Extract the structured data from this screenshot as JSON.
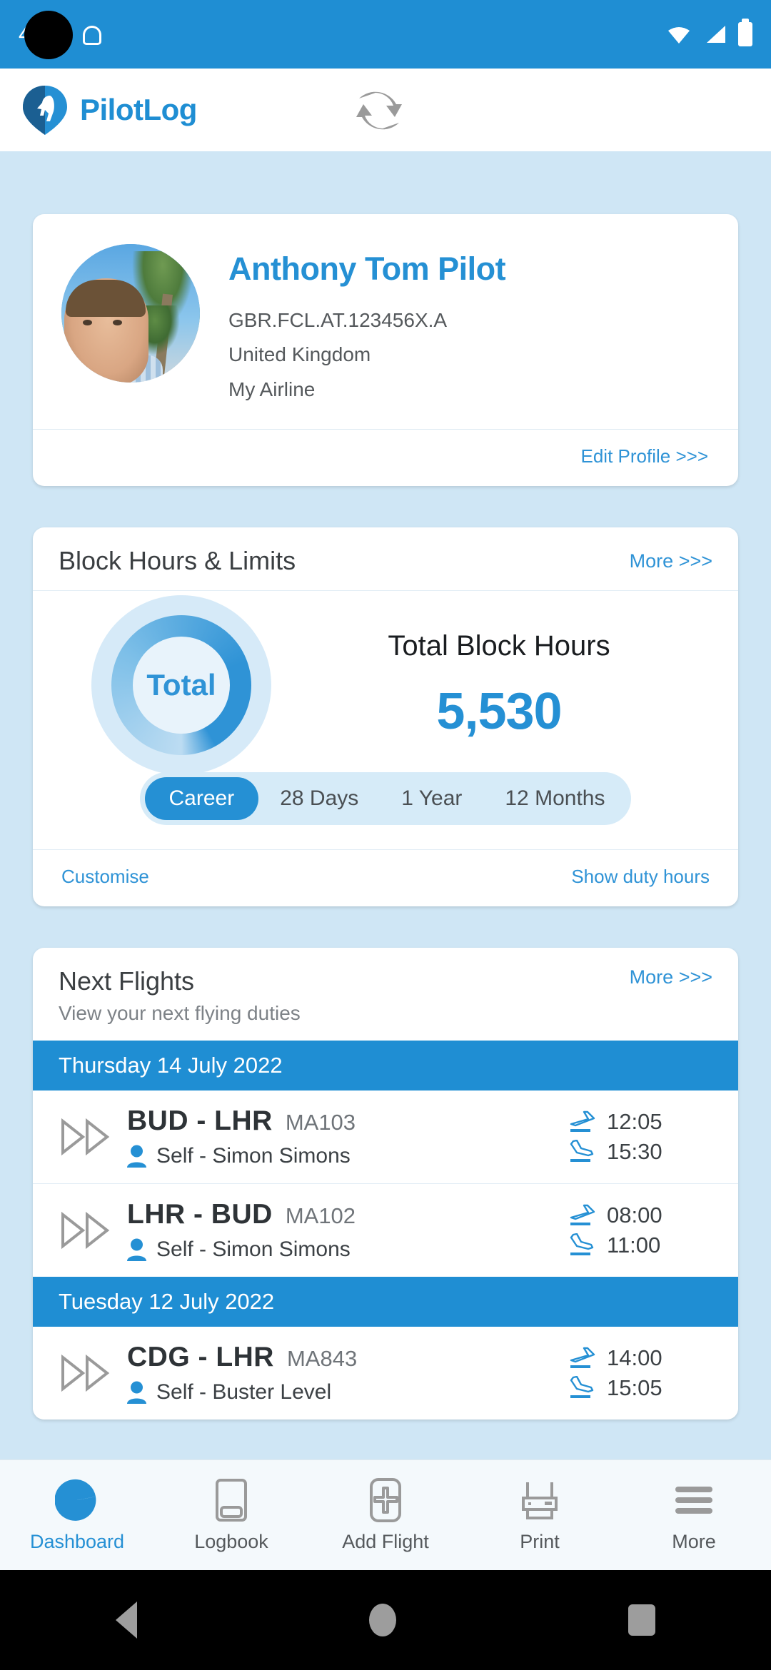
{
  "status_bar": {
    "time": "4",
    "icons": [
      "sd-card-icon",
      "android-icon",
      "wifi-icon",
      "signal-icon",
      "battery-icon"
    ]
  },
  "app_bar": {
    "title": "PilotLog",
    "logo_icon": "pilotlog-logo-icon",
    "sync_icon": "sync-icon"
  },
  "profile": {
    "name": "Anthony Tom Pilot",
    "licence": "GBR.FCL.AT.123456X.A",
    "country": "United Kingdom",
    "airline": "My Airline",
    "edit_link": "Edit Profile >>>",
    "avatar_name": "profile-photo"
  },
  "block_hours": {
    "title": "Block Hours & Limits",
    "more_label": "More >>>",
    "donut_label": "Total",
    "total_label": "Total Block Hours",
    "total_value": "5,530",
    "tabs": [
      {
        "label": "Career",
        "active": true
      },
      {
        "label": "28 Days",
        "active": false
      },
      {
        "label": "1 Year",
        "active": false
      },
      {
        "label": "12 Months",
        "active": false
      }
    ],
    "customise_label": "Customise",
    "duty_hours_label": "Show duty hours"
  },
  "next_flights": {
    "title": "Next Flights",
    "more_label": "More >>>",
    "subtitle": "View your next flying duties",
    "groups": [
      {
        "date": "Thursday 14 July 2022",
        "flights": [
          {
            "route": "BUD - LHR",
            "flight_number": "MA103",
            "crew": "Self - Simon Simons",
            "departure": "12:05",
            "arrival": "15:30"
          },
          {
            "route": "LHR - BUD",
            "flight_number": "MA102",
            "crew": "Self - Simon Simons",
            "departure": "08:00",
            "arrival": "11:00"
          }
        ]
      },
      {
        "date": "Tuesday 12 July 2022",
        "flights": [
          {
            "route": "CDG - LHR",
            "flight_number": "MA843",
            "crew": "Self - Buster Level",
            "departure": "14:00",
            "arrival": "15:05"
          }
        ]
      }
    ]
  },
  "tab_bar": {
    "items": [
      {
        "label": "Dashboard",
        "icon": "pie-chart-icon",
        "active": true
      },
      {
        "label": "Logbook",
        "icon": "book-icon",
        "active": false
      },
      {
        "label": "Add Flight",
        "icon": "add-flight-icon",
        "active": false
      },
      {
        "label": "Print",
        "icon": "printer-icon",
        "active": false
      },
      {
        "label": "More",
        "icon": "hamburger-icon",
        "active": false
      }
    ]
  },
  "android_nav": {
    "back": "back-button",
    "home": "home-button",
    "recents": "recents-button"
  },
  "colors": {
    "primary": "#1f8ed3",
    "accent": "#2590d4",
    "page_bg": "#cfe6f5",
    "card_bg": "#ffffff"
  }
}
